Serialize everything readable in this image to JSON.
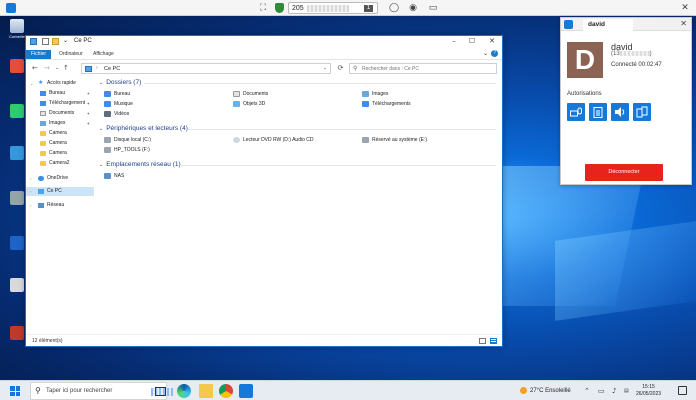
{
  "remote_toolbar": {
    "address_prefix": "205",
    "address_badge": "1",
    "icons": [
      "app-menu-icon",
      "fullscreen-icon",
      "shield-icon",
      "chat-icon",
      "record-icon",
      "window-icon",
      "close-icon"
    ]
  },
  "desktop_icons": [
    {
      "label": "Corbeille"
    },
    {
      "label": ""
    },
    {
      "label": ""
    },
    {
      "label": ""
    },
    {
      "label": ""
    },
    {
      "label": ""
    },
    {
      "label": ""
    },
    {
      "label": ""
    },
    {
      "label": ""
    }
  ],
  "explorer": {
    "title": "Ce PC",
    "ribbon_tabs": [
      "Fichier",
      "Ordinateur",
      "Affichage"
    ],
    "address": "Ce PC",
    "search_placeholder": "Rechercher dans : Ce PC",
    "nav": {
      "quick_access": "Accès rapide",
      "items": [
        "Bureau",
        "Téléchargement",
        "Documents",
        "Images",
        "Camera",
        "Camera",
        "Camera",
        "Camera2"
      ],
      "onedrive": "OneDrive",
      "this_pc": "Ce PC",
      "network": "Réseau"
    },
    "groups": {
      "folders": "Dossiers (7)",
      "drives": "Périphériques et lecteurs (4)",
      "network": "Emplacements réseau (1)"
    },
    "folders": [
      "Bureau",
      "Documents",
      "Images",
      "Musique",
      "Objets 3D",
      "Téléchargements",
      "Vidéos"
    ],
    "drives": [
      "Disque local (C:)",
      "Lecteur DVD RW (D:) Audio CD",
      "Réservé au système (E:)",
      "HP_TOOLS (F:)"
    ],
    "network_locations": [
      "NAS"
    ],
    "status": "12 élément(s)",
    "colors": {
      "accent": "#1979ca",
      "selection": "#cce4f7",
      "folder": "#f2c94c"
    }
  },
  "session_panel": {
    "tab_label": "david",
    "avatar_letter": "D",
    "user_name": "david",
    "user_id_prefix": "(13",
    "user_id_suffix": ")",
    "connection_status": "Connecté 00:02:47",
    "permissions_label": "Autorisations",
    "permission_icons": [
      "keyboard-mouse-icon",
      "clipboard-icon",
      "sound-icon",
      "file-transfer-icon"
    ],
    "disconnect_label": "Déconnecter",
    "colors": {
      "accent": "#1479d9",
      "disconnect": "#e8231b",
      "avatar": "#8b6355"
    }
  },
  "taskbar": {
    "search_placeholder": "Taper ici pour rechercher",
    "weather": "27°C  Ensoleillé",
    "time": "15:15",
    "date": "26/05/2023"
  }
}
